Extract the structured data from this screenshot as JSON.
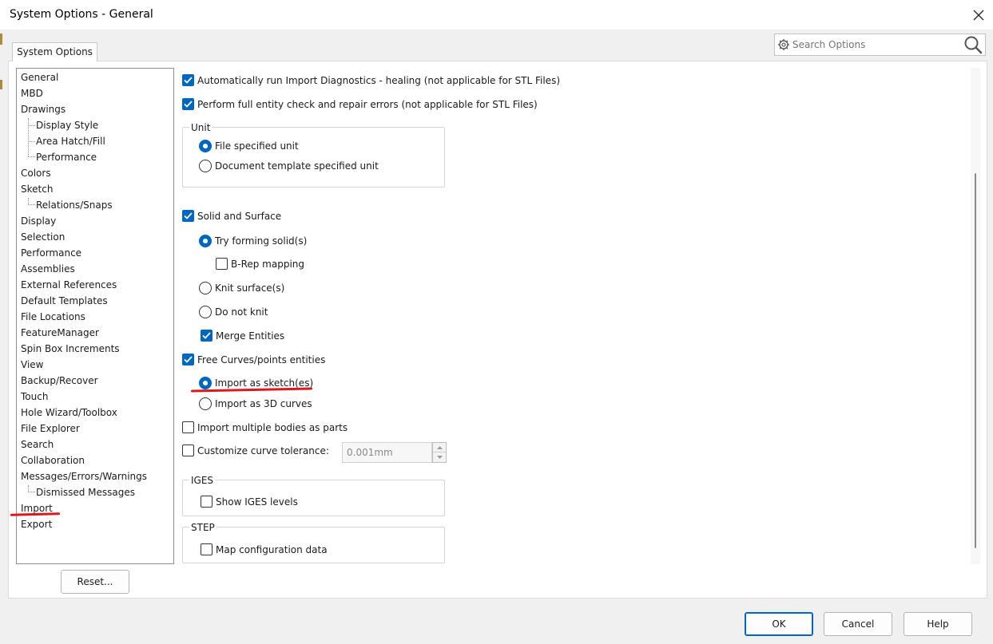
{
  "window": {
    "title": "System Options - General"
  },
  "tab": {
    "label": "System Options"
  },
  "search": {
    "placeholder": "Search Options",
    "gear_icon": "gear-icon",
    "search_icon": "magnifier-icon"
  },
  "tree": {
    "items": [
      "General",
      "MBD",
      "Drawings",
      "Display Style",
      "Area Hatch/Fill",
      "Performance",
      "Colors",
      "Sketch",
      "Relations/Snaps",
      "Display",
      "Selection",
      "Performance",
      "Assemblies",
      "External References",
      "Default Templates",
      "File Locations",
      "FeatureManager",
      "Spin Box Increments",
      "View",
      "Backup/Recover",
      "Touch",
      "Hole Wizard/Toolbox",
      "File Explorer",
      "Search",
      "Collaboration",
      "Messages/Errors/Warnings",
      "Dismissed Messages",
      "Import",
      "Export"
    ],
    "selected": "Import"
  },
  "reset_label": "Reset...",
  "options": {
    "auto_diag": "Automatically run Import Diagnostics - healing (not applicable for STL Files)",
    "full_check": "Perform full entity check and repair errors (not applicable for STL Files)",
    "unit_group": "Unit",
    "unit_file": "File specified unit",
    "unit_template": "Document template specified unit",
    "solid_surface": "Solid and Surface",
    "try_solid": "Try forming solid(s)",
    "brep": "B-Rep mapping",
    "knit": "Knit surface(s)",
    "no_knit": "Do not knit",
    "merge": "Merge Entities",
    "free_curves": "Free Curves/points entities",
    "as_sketch": "Import as sketch(es)",
    "as_3d": "Import as 3D curves",
    "multi_bodies": "Import multiple bodies as parts",
    "curve_tol": "Customize curve tolerance:",
    "curve_tol_value": "0.001mm",
    "iges_group": "IGES",
    "iges_levels": "Show IGES levels",
    "step_group": "STEP",
    "map_config": "Map configuration data"
  },
  "buttons": {
    "ok": "OK",
    "cancel": "Cancel",
    "help": "Help"
  },
  "colors": {
    "accent": "#0067c0",
    "annotation": "#d9181f"
  }
}
